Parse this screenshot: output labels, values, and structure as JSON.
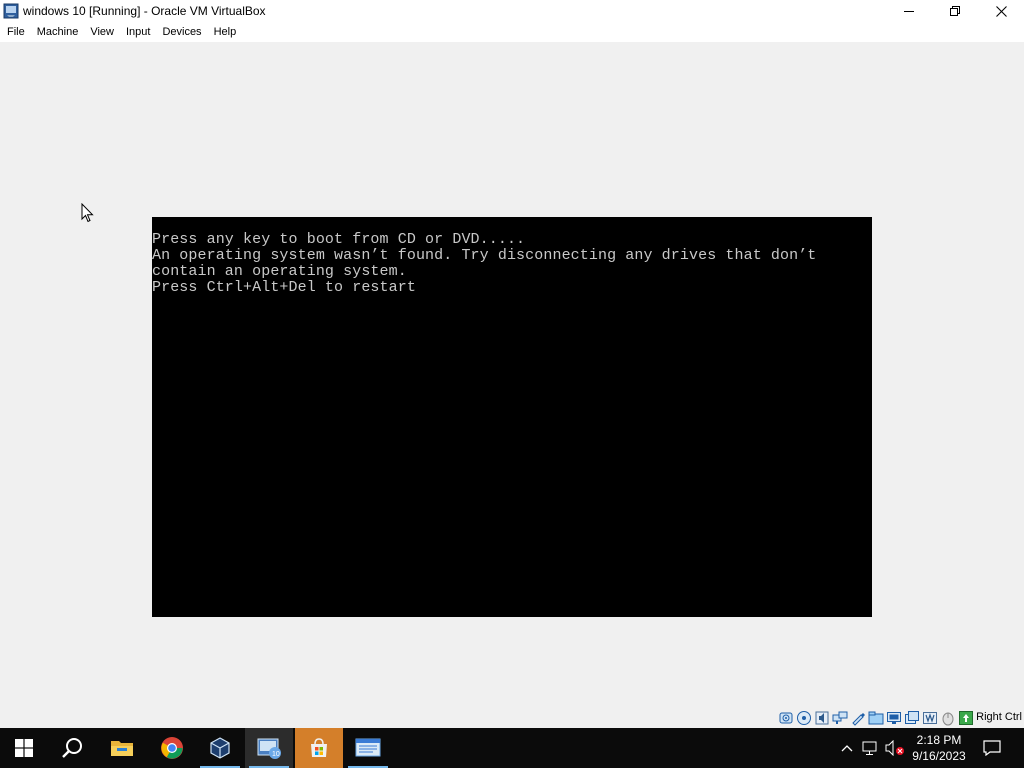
{
  "window": {
    "title": "windows 10 [Running] - Oracle VM VirtualBox",
    "controls": [
      "minimize-icon",
      "restore-icon",
      "close-icon"
    ]
  },
  "menu": {
    "items": [
      "File",
      "Machine",
      "View",
      "Input",
      "Devices",
      "Help"
    ]
  },
  "console": {
    "lines": [
      "Press any key to boot from CD or DVD.....",
      "An operating system wasn’t found. Try disconnecting any drives that don’t",
      "contain an operating system.",
      "Press Ctrl+Alt+Del to restart"
    ]
  },
  "statusbar": {
    "icons": [
      "hard-disk-icon",
      "optical-drive-icon",
      "audio-icon",
      "network-icon",
      "usb-icon",
      "shared-folders-icon",
      "display-icon",
      "video-capture-icon",
      "cpu-icon",
      "mouse-integration-icon",
      "keyboard-icon"
    ],
    "host_key": "Right Ctrl"
  },
  "taskbar": {
    "items": [
      "start-icon",
      "search-icon",
      "file-explorer-icon",
      "chrome-icon",
      "virtualbox-icon",
      "vm-window-icon",
      "store-icon",
      "network-app-icon"
    ],
    "tray_icons": [
      "chevron-up-icon",
      "network-icon",
      "volume-muted-icon",
      "notification-icon"
    ],
    "time": "2:18 PM",
    "date": "9/16/2023"
  },
  "colors": {
    "console_text": "#c8c8c8",
    "console_bg": "#000000",
    "taskbar_bg": "#0b0b0b",
    "active_underline": "#76b9ed"
  }
}
